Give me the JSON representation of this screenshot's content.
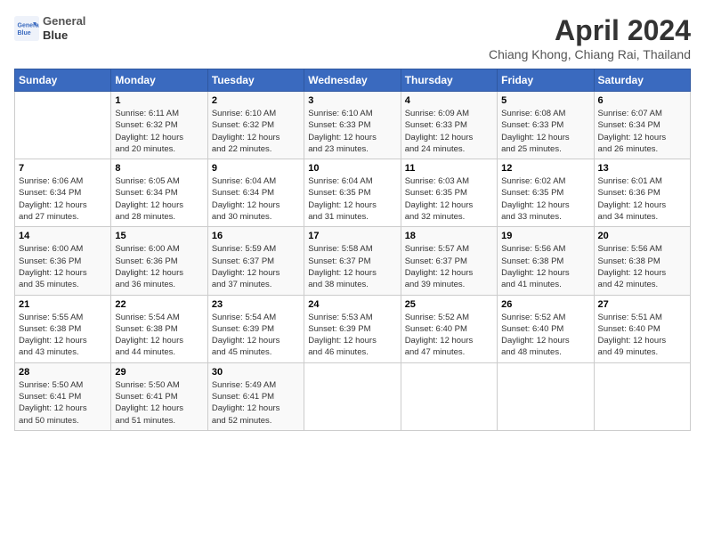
{
  "header": {
    "logo_line1": "General",
    "logo_line2": "Blue",
    "month_title": "April 2024",
    "location": "Chiang Khong, Chiang Rai, Thailand"
  },
  "days_of_week": [
    "Sunday",
    "Monday",
    "Tuesday",
    "Wednesday",
    "Thursday",
    "Friday",
    "Saturday"
  ],
  "weeks": [
    [
      {
        "day": "",
        "info": ""
      },
      {
        "day": "1",
        "info": "Sunrise: 6:11 AM\nSunset: 6:32 PM\nDaylight: 12 hours\nand 20 minutes."
      },
      {
        "day": "2",
        "info": "Sunrise: 6:10 AM\nSunset: 6:32 PM\nDaylight: 12 hours\nand 22 minutes."
      },
      {
        "day": "3",
        "info": "Sunrise: 6:10 AM\nSunset: 6:33 PM\nDaylight: 12 hours\nand 23 minutes."
      },
      {
        "day": "4",
        "info": "Sunrise: 6:09 AM\nSunset: 6:33 PM\nDaylight: 12 hours\nand 24 minutes."
      },
      {
        "day": "5",
        "info": "Sunrise: 6:08 AM\nSunset: 6:33 PM\nDaylight: 12 hours\nand 25 minutes."
      },
      {
        "day": "6",
        "info": "Sunrise: 6:07 AM\nSunset: 6:34 PM\nDaylight: 12 hours\nand 26 minutes."
      }
    ],
    [
      {
        "day": "7",
        "info": "Sunrise: 6:06 AM\nSunset: 6:34 PM\nDaylight: 12 hours\nand 27 minutes."
      },
      {
        "day": "8",
        "info": "Sunrise: 6:05 AM\nSunset: 6:34 PM\nDaylight: 12 hours\nand 28 minutes."
      },
      {
        "day": "9",
        "info": "Sunrise: 6:04 AM\nSunset: 6:34 PM\nDaylight: 12 hours\nand 30 minutes."
      },
      {
        "day": "10",
        "info": "Sunrise: 6:04 AM\nSunset: 6:35 PM\nDaylight: 12 hours\nand 31 minutes."
      },
      {
        "day": "11",
        "info": "Sunrise: 6:03 AM\nSunset: 6:35 PM\nDaylight: 12 hours\nand 32 minutes."
      },
      {
        "day": "12",
        "info": "Sunrise: 6:02 AM\nSunset: 6:35 PM\nDaylight: 12 hours\nand 33 minutes."
      },
      {
        "day": "13",
        "info": "Sunrise: 6:01 AM\nSunset: 6:36 PM\nDaylight: 12 hours\nand 34 minutes."
      }
    ],
    [
      {
        "day": "14",
        "info": "Sunrise: 6:00 AM\nSunset: 6:36 PM\nDaylight: 12 hours\nand 35 minutes."
      },
      {
        "day": "15",
        "info": "Sunrise: 6:00 AM\nSunset: 6:36 PM\nDaylight: 12 hours\nand 36 minutes."
      },
      {
        "day": "16",
        "info": "Sunrise: 5:59 AM\nSunset: 6:37 PM\nDaylight: 12 hours\nand 37 minutes."
      },
      {
        "day": "17",
        "info": "Sunrise: 5:58 AM\nSunset: 6:37 PM\nDaylight: 12 hours\nand 38 minutes."
      },
      {
        "day": "18",
        "info": "Sunrise: 5:57 AM\nSunset: 6:37 PM\nDaylight: 12 hours\nand 39 minutes."
      },
      {
        "day": "19",
        "info": "Sunrise: 5:56 AM\nSunset: 6:38 PM\nDaylight: 12 hours\nand 41 minutes."
      },
      {
        "day": "20",
        "info": "Sunrise: 5:56 AM\nSunset: 6:38 PM\nDaylight: 12 hours\nand 42 minutes."
      }
    ],
    [
      {
        "day": "21",
        "info": "Sunrise: 5:55 AM\nSunset: 6:38 PM\nDaylight: 12 hours\nand 43 minutes."
      },
      {
        "day": "22",
        "info": "Sunrise: 5:54 AM\nSunset: 6:38 PM\nDaylight: 12 hours\nand 44 minutes."
      },
      {
        "day": "23",
        "info": "Sunrise: 5:54 AM\nSunset: 6:39 PM\nDaylight: 12 hours\nand 45 minutes."
      },
      {
        "day": "24",
        "info": "Sunrise: 5:53 AM\nSunset: 6:39 PM\nDaylight: 12 hours\nand 46 minutes."
      },
      {
        "day": "25",
        "info": "Sunrise: 5:52 AM\nSunset: 6:40 PM\nDaylight: 12 hours\nand 47 minutes."
      },
      {
        "day": "26",
        "info": "Sunrise: 5:52 AM\nSunset: 6:40 PM\nDaylight: 12 hours\nand 48 minutes."
      },
      {
        "day": "27",
        "info": "Sunrise: 5:51 AM\nSunset: 6:40 PM\nDaylight: 12 hours\nand 49 minutes."
      }
    ],
    [
      {
        "day": "28",
        "info": "Sunrise: 5:50 AM\nSunset: 6:41 PM\nDaylight: 12 hours\nand 50 minutes."
      },
      {
        "day": "29",
        "info": "Sunrise: 5:50 AM\nSunset: 6:41 PM\nDaylight: 12 hours\nand 51 minutes."
      },
      {
        "day": "30",
        "info": "Sunrise: 5:49 AM\nSunset: 6:41 PM\nDaylight: 12 hours\nand 52 minutes."
      },
      {
        "day": "",
        "info": ""
      },
      {
        "day": "",
        "info": ""
      },
      {
        "day": "",
        "info": ""
      },
      {
        "day": "",
        "info": ""
      }
    ]
  ]
}
